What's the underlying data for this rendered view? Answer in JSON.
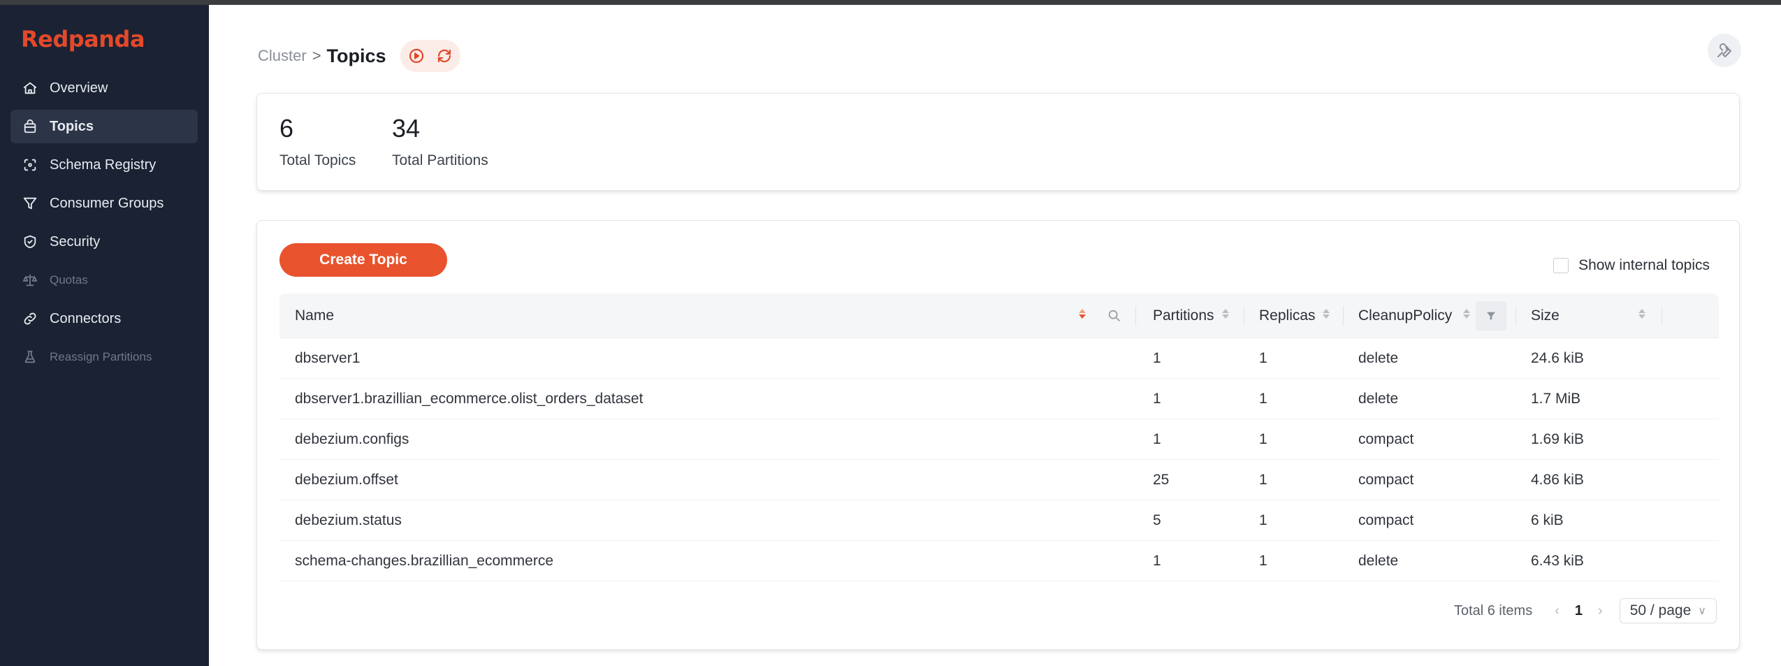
{
  "app": {
    "brand": "Redpanda",
    "brand_color": "#e2492a",
    "accent": "#e8532e"
  },
  "sidebar": {
    "items": [
      {
        "label": "Overview",
        "icon": "home-icon",
        "active": false,
        "disabled": false
      },
      {
        "label": "Topics",
        "icon": "bag-icon",
        "active": true,
        "disabled": false
      },
      {
        "label": "Schema Registry",
        "icon": "schema-icon",
        "active": false,
        "disabled": false
      },
      {
        "label": "Consumer Groups",
        "icon": "funnel-icon",
        "active": false,
        "disabled": false
      },
      {
        "label": "Security",
        "icon": "shield-icon",
        "active": false,
        "disabled": false
      },
      {
        "label": "Quotas",
        "icon": "scale-icon",
        "active": false,
        "disabled": true
      },
      {
        "label": "Connectors",
        "icon": "link-icon",
        "active": false,
        "disabled": false
      },
      {
        "label": "Reassign Partitions",
        "icon": "flask-icon",
        "active": false,
        "disabled": true
      }
    ]
  },
  "breadcrumb": {
    "parent": "Cluster",
    "separator": ">",
    "current": "Topics"
  },
  "stats": {
    "total_topics": {
      "value": "6",
      "label": "Total Topics"
    },
    "total_partitions": {
      "value": "34",
      "label": "Total Partitions"
    }
  },
  "topics": {
    "create_label": "Create Topic",
    "show_internal_label": "Show internal topics",
    "show_internal_checked": false,
    "columns": {
      "name": "Name",
      "partitions": "Partitions",
      "replicas": "Replicas",
      "policy": "CleanupPolicy",
      "size": "Size"
    },
    "rows": [
      {
        "name": "dbserver1",
        "partitions": "1",
        "replicas": "1",
        "policy": "delete",
        "size": "24.6 kiB"
      },
      {
        "name": "dbserver1.brazillian_ecommerce.olist_orders_dataset",
        "partitions": "1",
        "replicas": "1",
        "policy": "delete",
        "size": "1.7 MiB"
      },
      {
        "name": "debezium.configs",
        "partitions": "1",
        "replicas": "1",
        "policy": "compact",
        "size": "1.69 kiB"
      },
      {
        "name": "debezium.offset",
        "partitions": "25",
        "replicas": "1",
        "policy": "compact",
        "size": "4.86 kiB"
      },
      {
        "name": "debezium.status",
        "partitions": "5",
        "replicas": "1",
        "policy": "compact",
        "size": "6 kiB"
      },
      {
        "name": "schema-changes.brazillian_ecommerce",
        "partitions": "1",
        "replicas": "1",
        "policy": "delete",
        "size": "6.43 kiB"
      }
    ],
    "pagination": {
      "total": "Total 6 items",
      "current_page": "1",
      "page_size": "50 / page"
    }
  }
}
